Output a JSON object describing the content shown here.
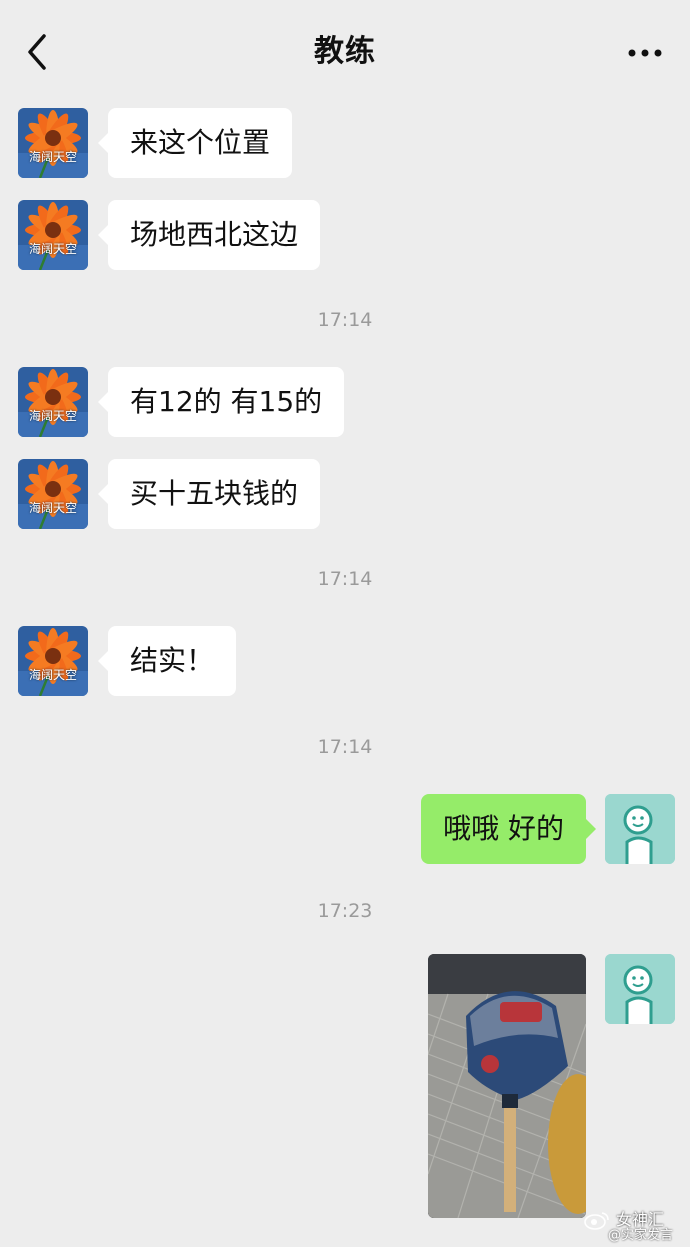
{
  "header": {
    "title": "教练",
    "back_icon": "chevron-left-icon",
    "more_icon": "more-dots-icon"
  },
  "contact": {
    "avatar_text": "海阔天空"
  },
  "messages": [
    {
      "type": "incoming",
      "text": "来这个位置"
    },
    {
      "type": "incoming",
      "text": "场地西北这边"
    },
    {
      "type": "time",
      "text": "17:14"
    },
    {
      "type": "incoming",
      "text": "有12的 有15的"
    },
    {
      "type": "incoming",
      "text": "买十五块钱的"
    },
    {
      "type": "time",
      "text": "17:14"
    },
    {
      "type": "incoming",
      "text": "结实！"
    },
    {
      "type": "time",
      "text": "17:14"
    },
    {
      "type": "outgoing",
      "text": "哦哦 好的"
    },
    {
      "type": "time",
      "text": "17:23"
    },
    {
      "type": "outgoing-image",
      "text": ""
    }
  ],
  "watermark": {
    "name": "女神汇",
    "sub": "@实家发言"
  },
  "colors": {
    "background": "#ededed",
    "incoming_bubble": "#ffffff",
    "outgoing_bubble": "#95ec69",
    "timestamp": "#9a9a9a"
  }
}
